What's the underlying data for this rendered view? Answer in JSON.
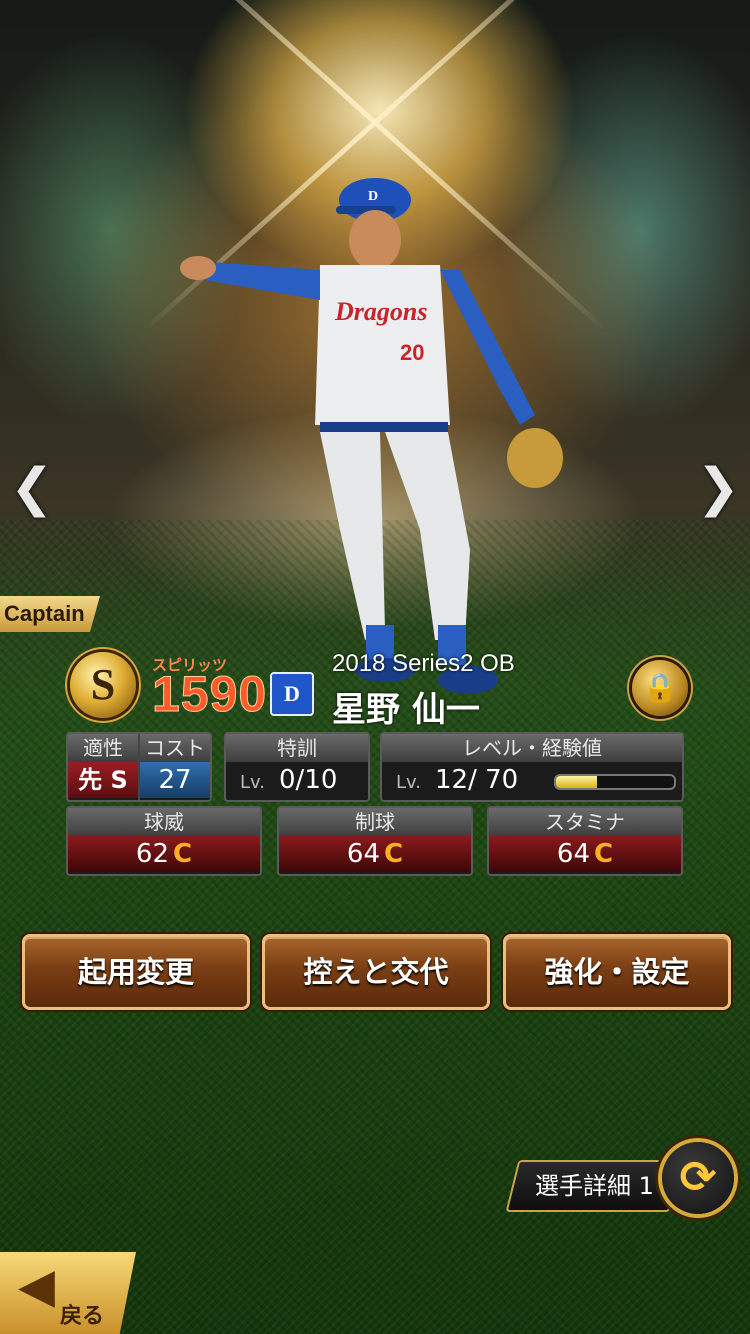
{
  "colors": {
    "spirits": "#ff5a2a",
    "grade": "#ffb020",
    "accent_gold": "#d8a53a",
    "button": "#7a3e14"
  },
  "nav": {
    "prev_icon": "chevron-left",
    "next_icon": "chevron-right",
    "prev_glyph": "❮",
    "next_glyph": "❯"
  },
  "captain": {
    "label": "Captain"
  },
  "card": {
    "rank": "S",
    "spirits_label": "スピリッツ",
    "spirits_value": "1590",
    "team_logo": "D",
    "series": "2018 Series2 OB",
    "name": "星野 仙一",
    "lock_icon": "🔒"
  },
  "aptitude": {
    "label": "適性",
    "value": "先 S",
    "cost_label": "コスト",
    "cost_value": "27"
  },
  "training": {
    "label": "特訓",
    "lv": "Lv.",
    "value": "0/10"
  },
  "level": {
    "label": "レベル・経験値",
    "lv": "Lv.",
    "value": "12/ 70",
    "xp_fraction": 0.35
  },
  "stats": [
    {
      "label": "球威",
      "value": "62",
      "grade": "C"
    },
    {
      "label": "制球",
      "value": "64",
      "grade": "C"
    },
    {
      "label": "スタミナ",
      "value": "64",
      "grade": "C"
    }
  ],
  "buttons": {
    "change": "起用変更",
    "bench": "控えと交代",
    "enhance": "強化・設定"
  },
  "detail": {
    "label": "選手詳細 1",
    "swap_icon": "⟳"
  },
  "back": {
    "label": "戻る",
    "arrow": "◀"
  }
}
